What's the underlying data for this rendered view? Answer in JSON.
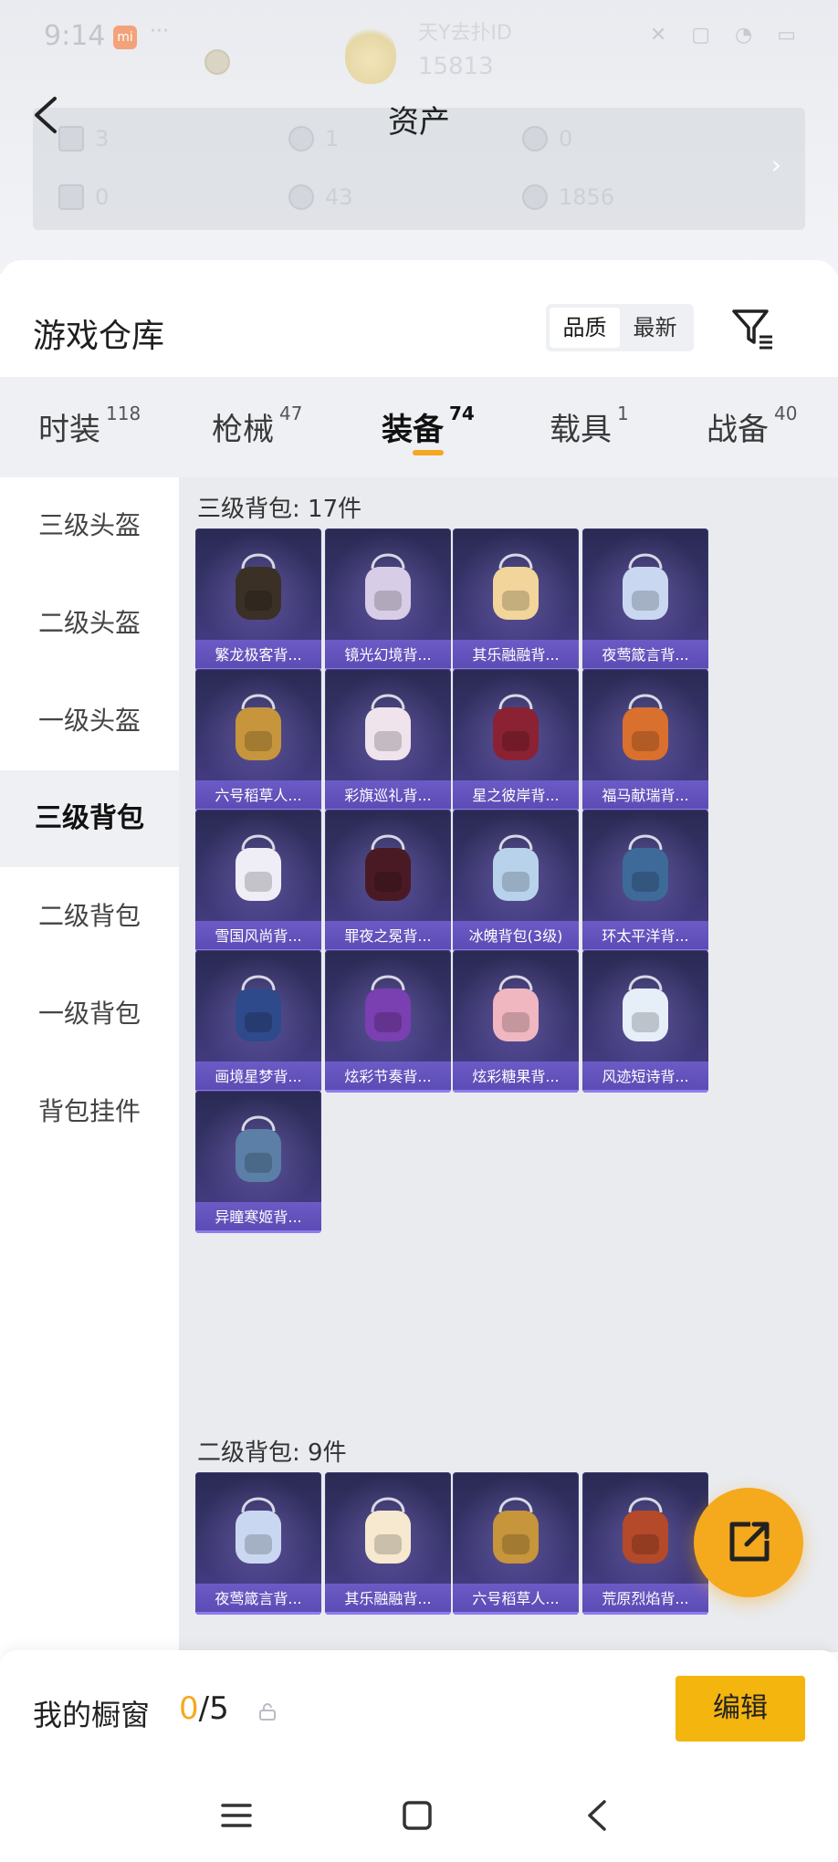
{
  "status_bar": {
    "time": "9:14",
    "carrier_badge": "mi",
    "extra": "···",
    "right": "✕ ▢ ◔ ▭"
  },
  "background": {
    "name_text": "天Y去扑ID",
    "score": "15813"
  },
  "header": {
    "title": "资产"
  },
  "assets": [
    {
      "value": "3"
    },
    {
      "value": "1"
    },
    {
      "value": "0"
    },
    {
      "value": "0"
    },
    {
      "value": "43"
    },
    {
      "value": "1856"
    }
  ],
  "warehouse": {
    "title": "游戏仓库",
    "sort_options": [
      "品质",
      "最新"
    ],
    "active_sort": "品质"
  },
  "tabs": [
    {
      "label": "时装",
      "count": "118"
    },
    {
      "label": "枪械",
      "count": "47"
    },
    {
      "label": "装备",
      "count": "74"
    },
    {
      "label": "载具",
      "count": "1"
    },
    {
      "label": "战备",
      "count": "40"
    }
  ],
  "sidebar": [
    {
      "label": "三级头盔"
    },
    {
      "label": "二级头盔"
    },
    {
      "label": "一级头盔"
    },
    {
      "label": "三级背包"
    },
    {
      "label": "二级背包"
    },
    {
      "label": "一级背包"
    },
    {
      "label": "背包挂件"
    }
  ],
  "sections": [
    {
      "title": "三级背包: 17件",
      "items": [
        {
          "name": "繁龙极客背...",
          "color": "#3b3026"
        },
        {
          "name": "镜光幻境背...",
          "color": "#d8cde6"
        },
        {
          "name": "其乐融融背...",
          "color": "#f1d59a"
        },
        {
          "name": "夜莺箴言背...",
          "color": "#c9d8f0"
        },
        {
          "name": "六号稻草人...",
          "color": "#c6953c"
        },
        {
          "name": "彩旗巡礼背...",
          "color": "#efe3ec"
        },
        {
          "name": "星之彼岸背...",
          "color": "#8a2233"
        },
        {
          "name": "福马献瑞背...",
          "color": "#d9702e"
        },
        {
          "name": "雪国风尚背...",
          "color": "#efeef6"
        },
        {
          "name": "罪夜之冕背...",
          "color": "#4a1a24"
        },
        {
          "name": "冰魄背包(3级)",
          "color": "#b9d2ec"
        },
        {
          "name": "环太平洋背...",
          "color": "#3e6a9a"
        },
        {
          "name": "画境星梦背...",
          "color": "#2f4a8a"
        },
        {
          "name": "炫彩节奏背...",
          "color": "#7a3fb0"
        },
        {
          "name": "炫彩糖果背...",
          "color": "#f0b7c0"
        },
        {
          "name": "风迹短诗背...",
          "color": "#e6eef8"
        },
        {
          "name": "异瞳寒姬背...",
          "color": "#5b7fa6"
        }
      ]
    },
    {
      "title": "二级背包: 9件",
      "items": [
        {
          "name": "夜莺箴言背...",
          "color": "#c9d8f0"
        },
        {
          "name": "其乐融融背...",
          "color": "#f6e9d0"
        },
        {
          "name": "六号稻草人...",
          "color": "#c6953c"
        },
        {
          "name": "荒原烈焰背...",
          "color": "#b44a2a"
        }
      ]
    }
  ],
  "showcase": {
    "label": "我的橱窗",
    "current": "0",
    "total": "/5",
    "edit_label": "编辑"
  },
  "colors": {
    "accent": "#f5a91d",
    "card_label": "#5a4ab2"
  }
}
